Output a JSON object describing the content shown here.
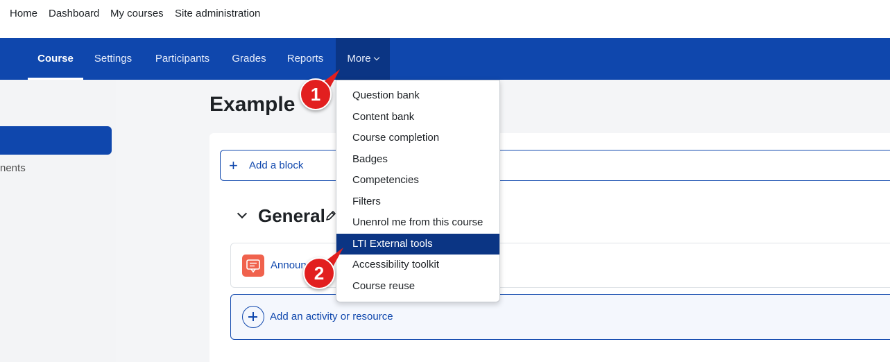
{
  "site_nav": {
    "items": [
      "Home",
      "Dashboard",
      "My courses",
      "Site administration"
    ]
  },
  "course_nav": {
    "tabs": [
      "Course",
      "Settings",
      "Participants",
      "Grades",
      "Reports"
    ],
    "more_label": "More",
    "active_tab": "Course"
  },
  "drawer": {
    "partial_item_label": "nents"
  },
  "page": {
    "title": "Example"
  },
  "blocks": {
    "add_block_label": "Add a block"
  },
  "section": {
    "title": "General",
    "activity_name": "Announ",
    "add_activity_label": "Add an activity or resource"
  },
  "more_menu": {
    "items": [
      "Question bank",
      "Content bank",
      "Course completion",
      "Badges",
      "Competencies",
      "Filters",
      "Unenrol me from this course",
      "LTI External tools",
      "Accessibility toolkit",
      "Course reuse"
    ],
    "highlighted": "LTI External tools"
  },
  "callouts": {
    "step1": "1",
    "step2": "2"
  },
  "colors": {
    "brand": "#0f47ad",
    "active_dark": "#0b3584",
    "callout": "#e21f1f",
    "announcement_icon": "#f0624d"
  },
  "icons": {
    "section_toggle": "chevron-down-icon",
    "edit": "pencil-icon",
    "announcement": "forum-icon",
    "add": "plus-icon"
  }
}
